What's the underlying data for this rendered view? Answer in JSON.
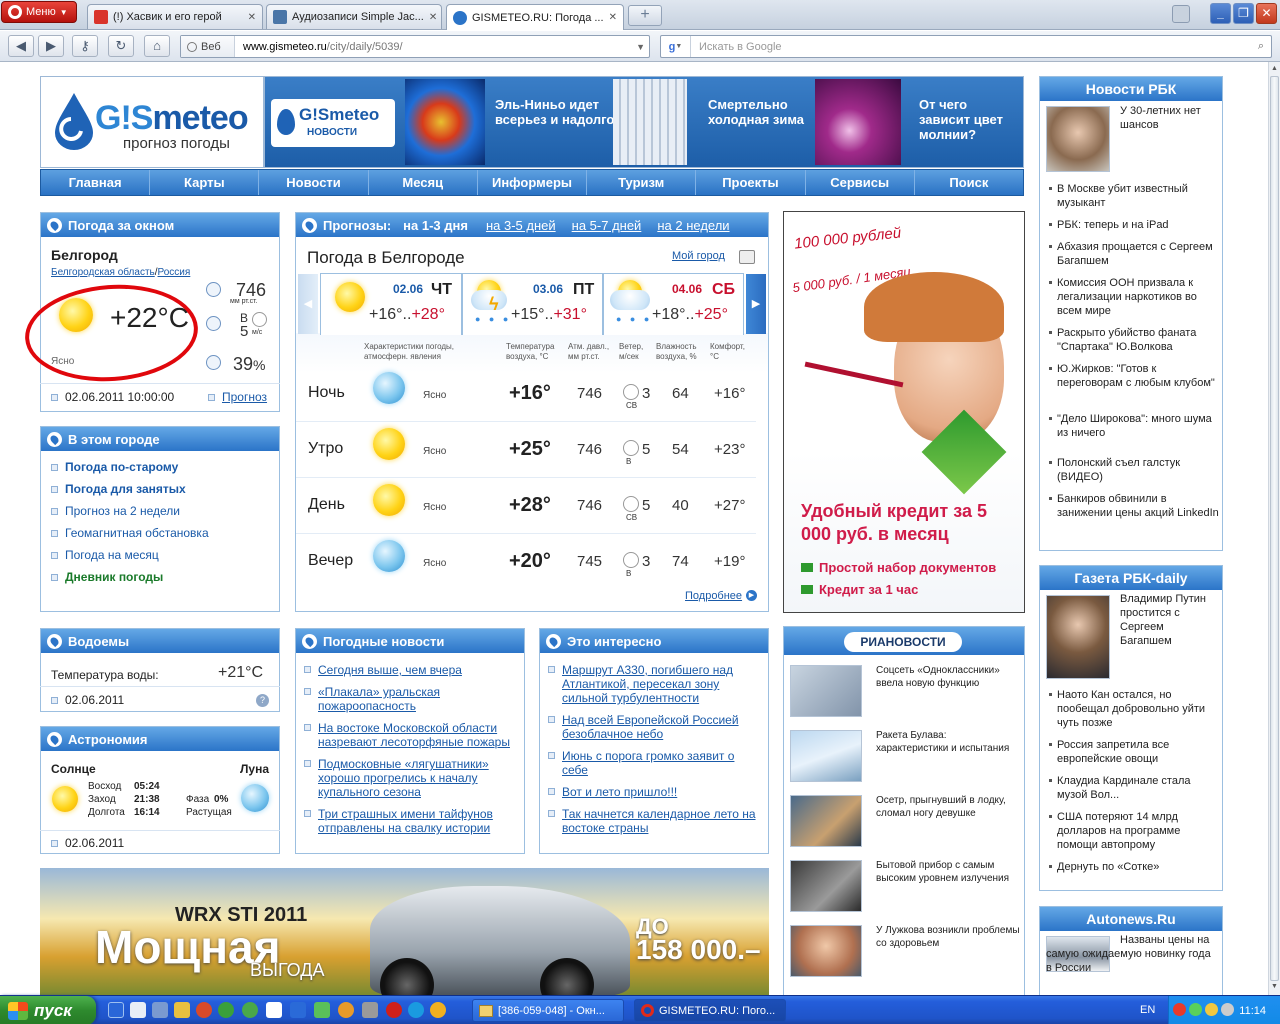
{
  "browser": {
    "menu_label": "Меню",
    "tabs": [
      {
        "title": "(!) Хасвик и его герой",
        "active": false
      },
      {
        "title": "Аудиозаписи Simple Jac...",
        "active": false
      },
      {
        "title": "GISMETEO.RU: Погода ...",
        "active": true
      }
    ],
    "addr_web": "Веб",
    "url_host": "www.gismeteo.ru",
    "url_path": "/city/daily/5039/",
    "search_placeholder": "Искать в Google"
  },
  "logo": {
    "brand_gi": "G!S",
    "brand_rest": "meteo",
    "slogan": "прогноз погоды"
  },
  "banner": {
    "news_brand": "G!Smeteo",
    "news_sub": "НОВОСТИ",
    "items": [
      "Эль-Ниньо идет всерьез и надолго",
      "Смертельно холодная зима",
      "От чего зависит цвет молнии?"
    ]
  },
  "nav": [
    "Главная",
    "Карты",
    "Новости",
    "Месяц",
    "Информеры",
    "Туризм",
    "Проекты",
    "Сервисы",
    "Поиск"
  ],
  "now": {
    "header": "Погода за окном",
    "city": "Белгород",
    "region": "Белгородская область",
    "sep": "/",
    "country": "Россия",
    "temp": "+22°C",
    "condition": "Ясно",
    "pressure": "746",
    "pressure_unit": "мм рт.ст.",
    "wind_dir": "В",
    "wind_speed": "5",
    "wind_unit": "м/с",
    "humidity": "39",
    "humidity_unit": "%",
    "datetime": "02.06.2011 10:00:00",
    "forecast_link": "Прогноз"
  },
  "city_box": {
    "header": "В этом городе",
    "links": [
      "Погода по-старому",
      "Погода для занятых",
      "Прогноз на 2 недели",
      "Геомагнитная обстановка",
      "Погода на месяц",
      "Дневник погоды"
    ]
  },
  "water": {
    "header": "Водоемы",
    "label": "Температура воды:",
    "value": "+21°C",
    "date": "02.06.2011"
  },
  "astro": {
    "header": "Астрономия",
    "sun_label": "Солнце",
    "moon_label": "Луна",
    "rise_label": "Восход",
    "rise": "05:24",
    "set_label": "Заход",
    "set": "21:38",
    "len_label": "Долгота",
    "len": "16:14",
    "phase_label": "Фаза",
    "phase": "0%",
    "phase_state": "Растущая",
    "date": "02.06.2011"
  },
  "forecast": {
    "header_label": "Прогнозы:",
    "tabs": [
      "на 1-3 дня",
      "на 3-5 дней",
      "на 5-7 дней",
      "на 2 недели"
    ],
    "title": "Погода в Белгороде",
    "my_city": "Мой город",
    "days": [
      {
        "date": "02.06",
        "dow": "ЧТ",
        "lo": "+16°",
        "sep": "..",
        "hi": "+28°"
      },
      {
        "date": "03.06",
        "dow": "ПТ",
        "lo": "+15°",
        "sep": "..",
        "hi": "+31°"
      },
      {
        "date": "04.06",
        "dow": "СБ",
        "lo": "+18°",
        "sep": "..",
        "hi": "+25°"
      }
    ],
    "columns": [
      "Характеристики погоды, атмосферн. явления",
      "Температура воздуха, °С",
      "Атм. давл., мм рт.ст.",
      "Ветер, м/сек",
      "Влажность воздуха, %",
      "Комфорт, °С"
    ],
    "rows": [
      {
        "part": "Ночь",
        "cond": "Ясно",
        "temp": "+16°",
        "press": "746",
        "wind_dir": "СВ",
        "wind": "3",
        "hum": "64",
        "comfort": "+16°"
      },
      {
        "part": "Утро",
        "cond": "Ясно",
        "temp": "+25°",
        "press": "746",
        "wind_dir": "В",
        "wind": "5",
        "hum": "54",
        "comfort": "+23°"
      },
      {
        "part": "День",
        "cond": "Ясно",
        "temp": "+28°",
        "press": "746",
        "wind_dir": "СВ",
        "wind": "5",
        "hum": "40",
        "comfort": "+27°"
      },
      {
        "part": "Вечер",
        "cond": "Ясно",
        "temp": "+20°",
        "press": "745",
        "wind_dir": "В",
        "wind": "3",
        "hum": "74",
        "comfort": "+19°"
      }
    ],
    "more_link": "Подробнее"
  },
  "ad": {
    "hand1": "100 000 рублей",
    "hand2": "5 000 руб. / 1 месяц",
    "headline": "Удобный кредит за 5 000 руб. в месяц",
    "bullets": [
      "Простой набор документов",
      "Кредит за 1 час"
    ]
  },
  "weather_news": {
    "header": "Погодные новости",
    "items": [
      "Сегодня выше, чем вчера",
      "«Плакала» уральская пожароопасность",
      "На востоке Московской области назревают лесоторфяные пожары",
      "Подмосковные «лягушатники» хорошо прогрелись к началу купального сезона",
      "Три страшных имени тайфунов отправлены на свалку истории"
    ]
  },
  "interesting": {
    "header": "Это интересно",
    "items": [
      "Маршрут А330, погибшего над Атлантикой, пересекал зону сильной турбулентности",
      "Над всей Европейской Россией безоблачное небо",
      "Июнь с порога громко заявит о себе",
      "Вот и лето пришло!!!",
      "Так начнется календарное лето на востоке страны"
    ]
  },
  "ria": {
    "brand": "РИАНОВОСТИ",
    "items": [
      "Соцсеть «Одноклассники» ввела новую функцию",
      "Ракета Булава: характеристики и испытания",
      "Осетр, прыгнувший в лодку, сломал ногу девушке",
      "Бытовой прибор с самым высоким уровнем излучения",
      "У Лужкова возникли проблемы со здоровьем"
    ]
  },
  "car_ad": {
    "model": "WRX STI 2011",
    "big": "Мощная",
    "small": "ВЫГОДА",
    "upto": "ДО",
    "price": "158 000.–"
  },
  "rbk": {
    "header": "Новости РБК",
    "lead": "У 30-летних нет шансов",
    "items": [
      "В Москве убит известный музыкант",
      "РБК: теперь и на iPad",
      "Абхазия прощается с Сергеем Багапшем",
      "Комиссия ООН призвала к легализации наркотиков во всем мире",
      "Раскрыто убийство фаната \"Спартака\" Ю.Волкова",
      "Ю.Жирков: \"Готов к переговорам с любым клубом\"",
      "\"Дело Широкова\": много шума из ничего",
      "Полонский съел галстук (ВИДЕО)",
      "Банкиров обвинили в занижении цены акций LinkedIn"
    ]
  },
  "rbk_daily": {
    "header": "Газета РБК-daily",
    "lead": "Владимир Путин простится с Сергеем Багапшем",
    "items": [
      "Наото Кан остался, но пообещал добровольно уйти чуть позже",
      "Россия запретила все европейские овощи",
      "Клаудиа Кардинале стала музой Вол...",
      "США потеряют 14 млрд долларов на программе помощи автопрому",
      "Дернуть по «Сотке»"
    ]
  },
  "autonews": {
    "header": "Autonews.Ru",
    "lead": "Названы цены на самую ожидаемую новинку года в России"
  },
  "taskbar": {
    "start": "пуск",
    "tasks": [
      "[386-059-048] - Окн...",
      "GISMETEO.RU: Пого..."
    ],
    "lang": "EN",
    "time": "11:14"
  },
  "colors": {
    "accent": "#2b74c8",
    "hot": "#c8102e",
    "ad_red": "#d01c4a",
    "ad_green": "#2e9a2e"
  }
}
